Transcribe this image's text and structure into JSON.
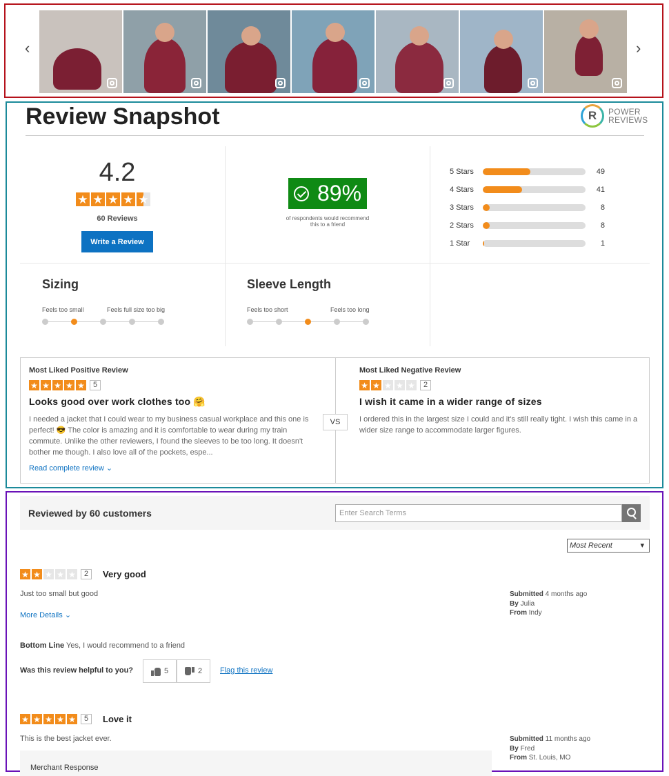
{
  "gallery": {
    "prev_label": "‹",
    "next_label": "›",
    "photos": [
      {
        "bg": "#c9c2bd",
        "jacket": "#7b1f33",
        "label": "shoes-and-jacket"
      },
      {
        "bg": "#8fa0a8",
        "jacket": "#8a2438",
        "label": "woman-on-bridge"
      },
      {
        "bg": "#6f8a9a",
        "jacket": "#7a1e30",
        "label": "man-on-boat"
      },
      {
        "bg": "#7fa3b8",
        "jacket": "#86223a",
        "label": "woman-by-lake"
      },
      {
        "bg": "#a9b7c2",
        "jacket": "#8b2a3f",
        "label": "woman-smiling"
      },
      {
        "bg": "#9fb5c8",
        "jacket": "#6d1c2c",
        "label": "man-skyline"
      },
      {
        "bg": "#b8b0a4",
        "jacket": "#7e2034",
        "label": "woman-stretching"
      }
    ]
  },
  "snapshot": {
    "title": "Review Snapshot",
    "logo_top": "POWER",
    "logo_bottom": "REVIEWS",
    "logo_letter": "R",
    "average": "4.2",
    "rating_value": 4.2,
    "review_count": "60 Reviews",
    "write_button": "Write a Review",
    "recommend_pct": "89%",
    "recommend_caption": "of respondents would recommend this to a friend",
    "histogram": [
      {
        "label": "5 Stars",
        "count": "49",
        "fraction": 0.46
      },
      {
        "label": "4 Stars",
        "count": "41",
        "fraction": 0.38
      },
      {
        "label": "3 Stars",
        "count": "8",
        "fraction": 0.07
      },
      {
        "label": "2 Stars",
        "count": "8",
        "fraction": 0.07
      },
      {
        "label": "1 Star",
        "count": "1",
        "fraction": 0.01
      }
    ],
    "sizing": {
      "title": "Sizing",
      "left_label": "Feels too small",
      "right_label": "Feels full size too big",
      "selected": 2
    },
    "sleeve": {
      "title": "Sleeve Length",
      "left_label": "Feels too short",
      "right_label": "Feels too long",
      "selected": 3
    },
    "faceoff": {
      "vs": "VS",
      "positive": {
        "heading": "Most Liked Positive Review",
        "rating": 5,
        "rating_text": "5",
        "title": "Looks good over work clothes too 🤗",
        "body": "I needed a jacket that I could wear to my business casual workplace and this one is perfect! 😎 The color is amazing and it is comfortable to wear during my train commute. Unlike the other reviewers, I found the sleeves to be too long. It doesn't bother me though. I also love all of the pockets, espe...",
        "link": "Read complete review"
      },
      "negative": {
        "heading": "Most Liked Negative Review",
        "rating": 2,
        "rating_text": "2",
        "title": "I wish it came in a wider range of sizes",
        "body": "I ordered this in the largest size I could and it's still really tight. I wish this came in a wider size range to accommodate larger figures."
      }
    }
  },
  "reviews": {
    "header": "Reviewed by 60 customers",
    "search_placeholder": "Enter Search Terms",
    "sort_value": "Most Recent",
    "items": [
      {
        "rating": 2,
        "rating_text": "2",
        "headline": "Very good",
        "body": "Just too small but good",
        "submitted_label": "Submitted",
        "submitted": "4 months ago",
        "by_label": "By",
        "by": "Julia",
        "from_label": "From",
        "from": "Indy",
        "more_details": "More Details",
        "bottom_line_label": "Bottom Line",
        "bottom_line": "Yes, I would recommend to a friend",
        "helpful_question": "Was this review helpful to you?",
        "helpful_yes": "5",
        "helpful_no": "2",
        "flag": "Flag this review"
      },
      {
        "rating": 5,
        "rating_text": "5",
        "headline": "Love it",
        "body": "This is the best jacket ever.",
        "submitted_label": "Submitted",
        "submitted": "11 months ago",
        "by_label": "By",
        "by": "Fred",
        "from_label": "From",
        "from": "St. Louis, MO",
        "merchant_label": "Merchant Response"
      }
    ]
  },
  "colors": {
    "accent": "#f28c1b",
    "link": "#0d72c2",
    "recommend": "#0f8a14"
  },
  "icons": [
    "chevron-left-icon",
    "chevron-right-icon",
    "instagram-icon",
    "star-icon",
    "check-circle-icon",
    "search-icon",
    "thumbs-up-icon",
    "thumbs-down-icon",
    "chevron-down-icon"
  ]
}
